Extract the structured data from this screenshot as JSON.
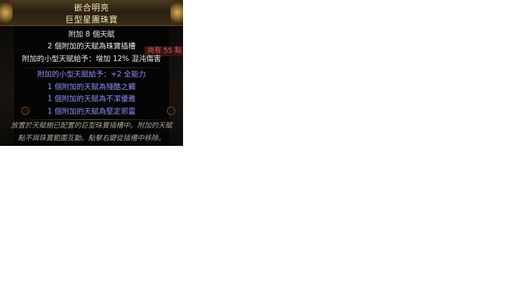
{
  "tooltip": {
    "title": "嵌合明亮",
    "base_type": "巨型星團珠寶",
    "mods_white": [
      "附加 8 個天賦",
      "2 個附加的天賦為珠寶插槽",
      "附加的小型天賦給予：增加 12% 混沌傷害"
    ],
    "mods_blue": [
      "附加的小型天賦給予：+2 全能力",
      "1 個附加的天賦為殘酷之觸",
      "1 個附加的天賦為不潔優雅",
      "1 個附加的天賦為堅定邪靈"
    ],
    "description": [
      "放置於天賦樹已配置的巨型珠寶插槽中。附加的天賦",
      "點不與珠寶範圍互動。點擊右鍵從插槽中移除。"
    ]
  },
  "background_hint": "尚有 55 點",
  "colors": {
    "header_text": "#f0e2b0",
    "mod_white": "#e6e6e6",
    "mod_blue": "#8c8cf0",
    "description": "#a8a196"
  }
}
